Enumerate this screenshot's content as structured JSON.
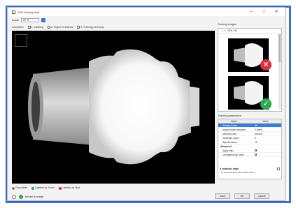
{
  "window": {
    "title": "Edit training data",
    "minimize": "–",
    "maximize": "□",
    "close": "✕"
  },
  "zoom": {
    "label": "Zoom",
    "value": "87 %"
  },
  "toolbar": {
    "label": "Annotation",
    "items": [
      "1: Labeling",
      "2: Region of interest",
      "3: Training previously"
    ]
  },
  "legend": {
    "items": [
      {
        "label": "Good state",
        "color": "#888888"
      },
      {
        "label": "Labeled as 'Good'",
        "color": "#2fa84f"
      },
      {
        "label": "Labeled as 'Bad'",
        "color": "#d9313d"
      }
    ]
  },
  "status": {
    "text": "Model is ready"
  },
  "footer": {
    "buttons": [
      "Save",
      "OK",
      "Cancel"
    ]
  },
  "training_images": {
    "title": "Training images",
    "header_count": "0/26 / 40",
    "items": [
      {
        "badge": "✕",
        "state": "bad",
        "color": "#d9313d"
      },
      {
        "badge": "✓",
        "state": "good",
        "color": "#2fa84f"
      }
    ]
  },
  "properties": {
    "title": "Training parameters",
    "columns": [
      "Name",
      "Value"
    ],
    "rows": [
      {
        "name": "Selected class",
        "value": "All",
        "selected": true
      },
      {
        "name": "Include state unknown",
        "value": "0 items"
      },
      {
        "name": "Minimum size",
        "value": "Normal"
      },
      {
        "name": "Maximum count",
        "value": "5"
      },
      {
        "name": "Specific factor",
        "value": "10"
      }
    ],
    "section": "Advanced",
    "advanced_rows": [
      {
        "name": "Apply step",
        "value": ""
      },
      {
        "name": "Confidence per state",
        "value": ""
      }
    ],
    "description_title": "If enabled, state",
    "description_text": "The selected class will be filled within."
  }
}
